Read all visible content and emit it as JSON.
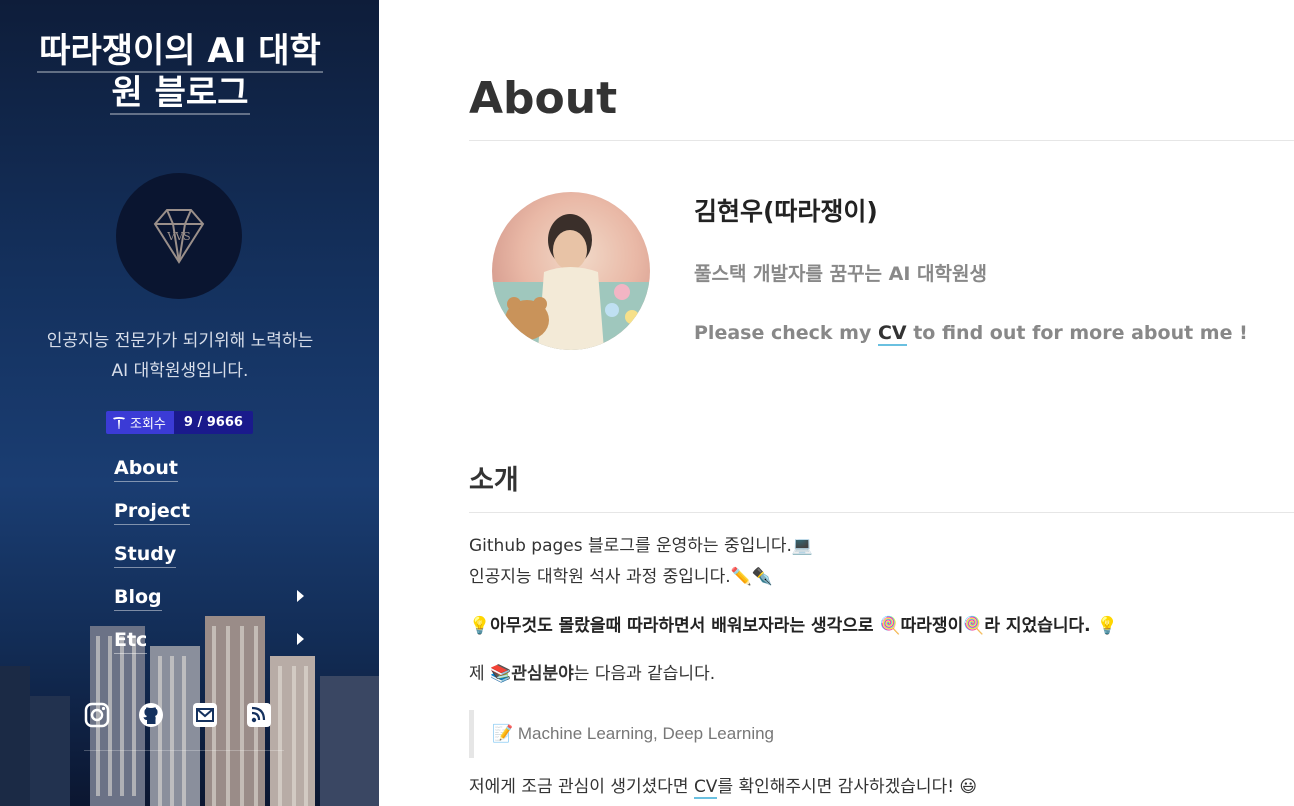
{
  "sidebar": {
    "title_line1": "따라쟁이의 AI 대학",
    "title_line2": "원 블로그",
    "logo_text": "VVS",
    "description_line1": "인공지능 전문가가 되기위해 노력하는",
    "description_line2": "AI 대학원생입니다.",
    "hits": {
      "label": "조회수",
      "value": "9 / 9666"
    },
    "nav": [
      {
        "label": "About",
        "has_submenu": false
      },
      {
        "label": "Project",
        "has_submenu": false
      },
      {
        "label": "Study",
        "has_submenu": false
      },
      {
        "label": "Blog",
        "has_submenu": true
      },
      {
        "label": "Etc",
        "has_submenu": true
      }
    ],
    "socials": [
      "instagram-icon",
      "github-icon",
      "email-icon",
      "rss-icon"
    ]
  },
  "main": {
    "page_title": "About",
    "profile": {
      "name": "김현우(따라쟁이)",
      "tagline": "풀스택 개발자를 꿈꾸는 AI 대학원생",
      "cv_prefix": "Please check my ",
      "cv_link": "CV",
      "cv_suffix": " to find out for more about me !"
    },
    "intro": {
      "heading": "소개",
      "line1": "Github pages 블로그를 운영하는 중입니다.💻",
      "line2": "인공지능 대학원 석사 과정 중입니다.✏️✒️",
      "line3": "💡아무것도 몰랐을때 따라하면서 배워보자라는 생각으로 🍭따라쟁이🍭라 지었습니다. 💡",
      "interest_prefix": "제 ",
      "interest_emoji": "📚",
      "interest_bold": "관심분야",
      "interest_suffix": "는 다음과 같습니다.",
      "quote": "📝 Machine Learning, Deep Learning",
      "closing_prefix": "저에게 조금 관심이 생기셨다면 ",
      "closing_link": "CV",
      "closing_suffix": "를 확인해주시면 감사하겠습니다! 😃"
    }
  },
  "colors": {
    "sidebar_top": "#0e1d3a",
    "sidebar_bottom": "#0b1630",
    "link_underline": "#6ac0e0",
    "hits_label_bg": "#3b3bd6",
    "hits_value_bg": "#1a1a8c"
  }
}
